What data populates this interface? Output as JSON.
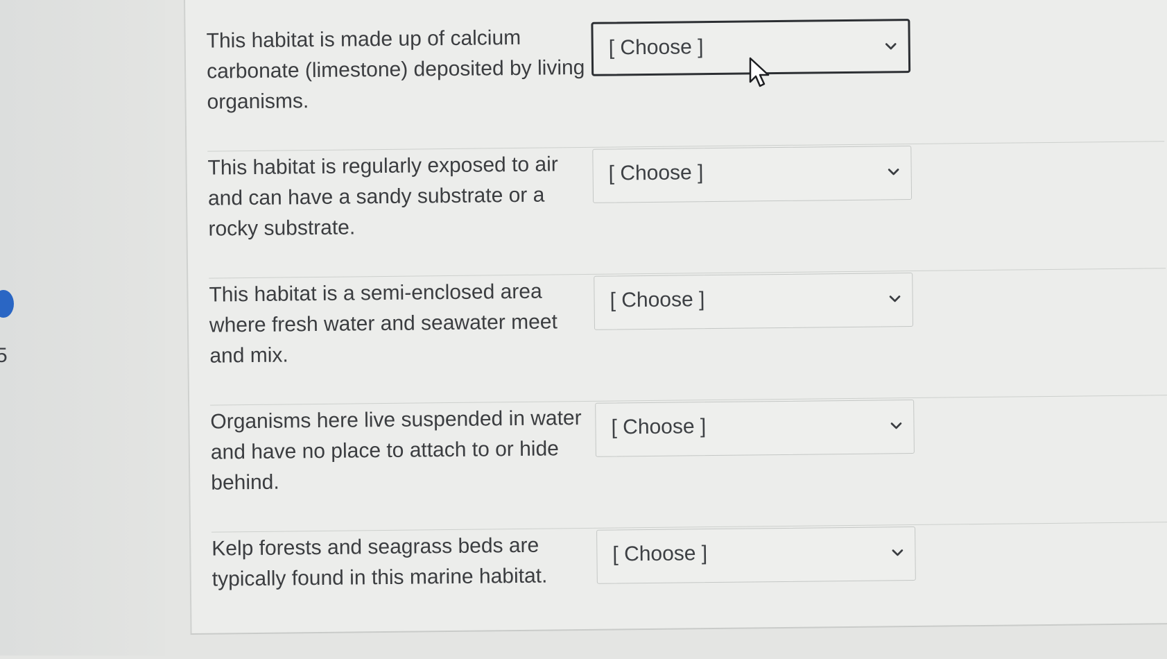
{
  "side_nav": {
    "question_number": "5"
  },
  "matching_rows": [
    {
      "prompt": "This habitat is made up of calcium carbonate (limestone) deposited by living organisms.",
      "selected_value": "[ Choose ]",
      "focused": true
    },
    {
      "prompt": "This habitat is regularly exposed to air and can have a sandy substrate or a rocky substrate.",
      "selected_value": "[ Choose ]"
    },
    {
      "prompt": "This habitat is a semi-enclosed area where fresh water and seawater meet and mix.",
      "selected_value": "[ Choose ]"
    },
    {
      "prompt": "Organisms here live suspended in water and have no place to attach to or hide behind.",
      "selected_value": "[ Choose ]"
    },
    {
      "prompt": "Kelp forests and seagrass beds are typically found in this marine habitat.",
      "selected_value": "[ Choose ]"
    }
  ],
  "icons": {
    "dropdown": "chevron-down-icon",
    "cursor": "mouse-cursor-icon"
  },
  "colors": {
    "progress_dot": "#2a66c4",
    "focused_border": "#2c2f33"
  }
}
